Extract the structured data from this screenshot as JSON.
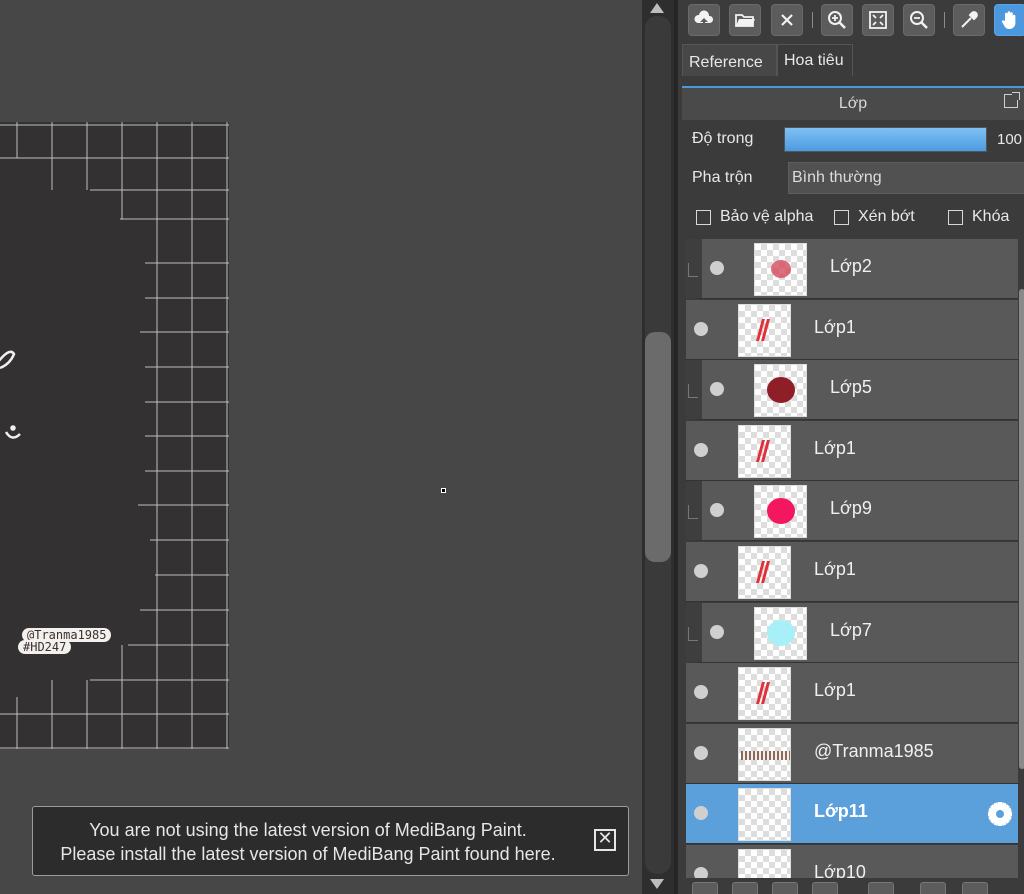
{
  "canvas": {
    "watermark_line1": "@Tranma1985",
    "watermark_line2": "#HD247"
  },
  "notification": {
    "line1": "You are not using the latest version of MediBang Paint.",
    "line2": "Please install the latest version of MediBang Paint found here.",
    "close_symbol": "✕"
  },
  "toolbar": {
    "buttons": [
      "cloud-upload-icon",
      "folder-open-icon",
      "close-icon",
      "zoom-in-icon",
      "fit-screen-icon",
      "zoom-out-icon",
      "eyedropper-icon",
      "hand-icon"
    ],
    "active": "hand-icon",
    "accent": "#4b98de"
  },
  "tabs": {
    "reference": "Reference",
    "navigator": "Hoa tiêu"
  },
  "layer_panel": {
    "title": "Lớp",
    "opacity_label": "Độ trong",
    "opacity_value": "100",
    "opacity_fraction": 1.0,
    "blend_label": "Pha trộn",
    "blend_value": "Bình thường",
    "protect_alpha": "Bảo vệ alpha",
    "clipping": "Xén bớt",
    "lock": "Khóa",
    "layers": [
      {
        "name": "Lớp2",
        "clip": true,
        "thumb": "pink-blob",
        "color": "#d44a5c"
      },
      {
        "name": "Lớp1",
        "clip": false,
        "thumb": "red-stroke",
        "color": "#e0303a"
      },
      {
        "name": "Lớp5",
        "clip": true,
        "thumb": "dark-red-blob",
        "color": "#8e1f28"
      },
      {
        "name": "Lớp1",
        "clip": false,
        "thumb": "red-stroke",
        "color": "#e0303a"
      },
      {
        "name": "Lớp9",
        "clip": true,
        "thumb": "magenta-blob",
        "color": "#f2175e"
      },
      {
        "name": "Lớp1",
        "clip": false,
        "thumb": "red-stroke",
        "color": "#e0303a"
      },
      {
        "name": "Lớp7",
        "clip": true,
        "thumb": "cyan-blob",
        "color": "#a8f0f8"
      },
      {
        "name": "Lớp1",
        "clip": false,
        "thumb": "red-stroke",
        "color": "#e0303a"
      },
      {
        "name": "@Tranma1985",
        "clip": false,
        "thumb": "text-strip",
        "color": "#8a6a5a"
      },
      {
        "name": "Lớp11",
        "clip": false,
        "thumb": "empty",
        "color": "",
        "selected": true
      },
      {
        "name": "Lớp10",
        "clip": false,
        "thumb": "empty",
        "color": ""
      }
    ]
  }
}
